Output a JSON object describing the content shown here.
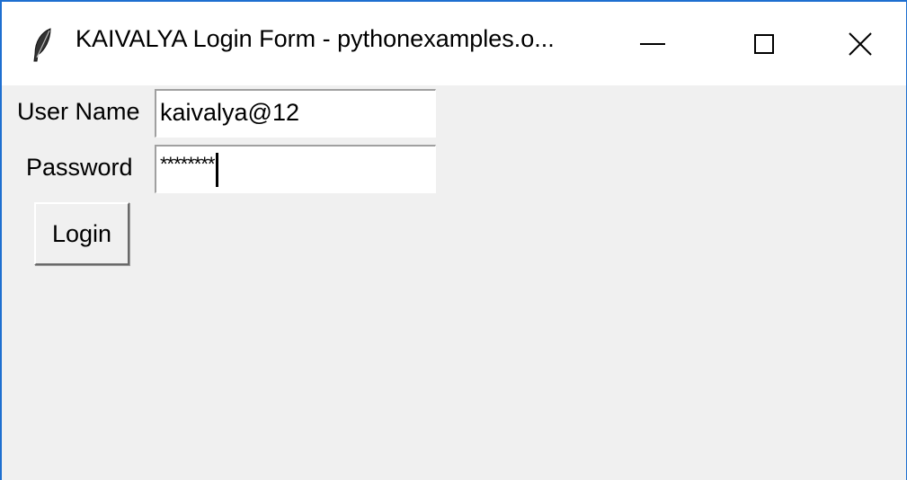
{
  "window": {
    "title": "KAIVALYA Login Form - pythonexamples.o...",
    "app_icon": "feather-icon",
    "accent_color": "#1e6fd0"
  },
  "form": {
    "username_label": "User Name",
    "username_value": "kaivalya@12",
    "password_label": "Password",
    "password_value": "********",
    "login_label": "Login"
  }
}
